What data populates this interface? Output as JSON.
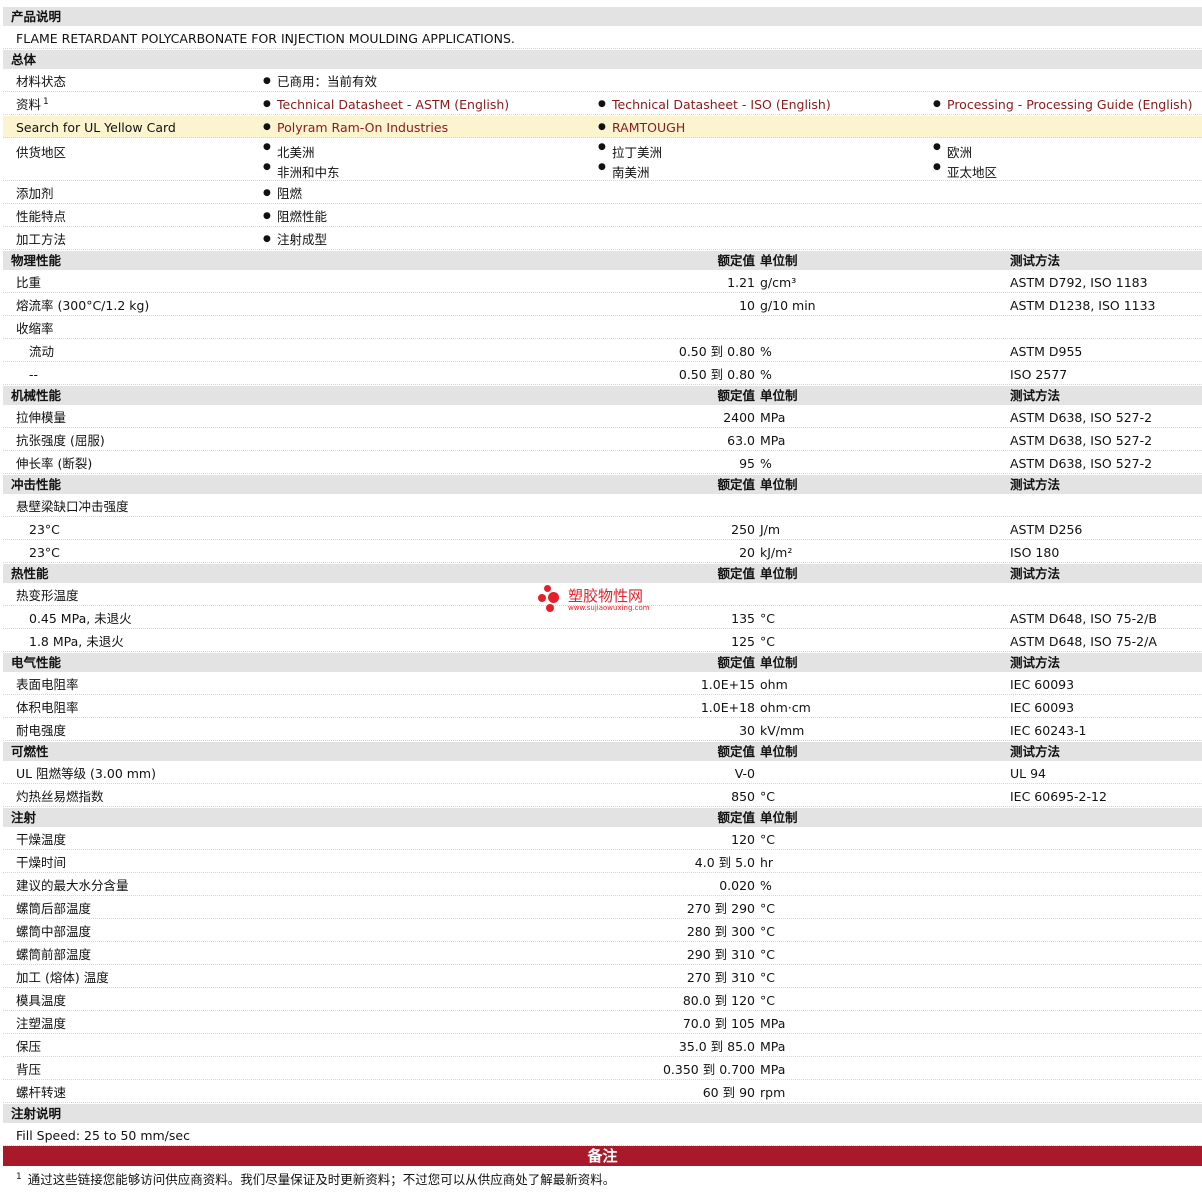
{
  "product_description": {
    "header": "产品说明",
    "text": "FLAME RETARDANT POLYCARBONATE FOR INJECTION MOULDING APPLICATIONS."
  },
  "general": {
    "header": "总体",
    "material_status": {
      "label": "材料状态",
      "value": "已商用：当前有效"
    },
    "documents": {
      "label": "资料",
      "footnote": "1",
      "links": [
        "Technical Datasheet - ASTM (English)",
        "Technical Datasheet - ISO (English)",
        "Processing - Processing Guide (English)"
      ]
    },
    "ul_card": {
      "label": "Search for UL Yellow Card",
      "links": [
        "Polyram Ram-On Industries",
        "RAMTOUGH"
      ]
    },
    "availability": {
      "label": "供货地区",
      "values": [
        "北美洲",
        "拉丁美洲",
        "欧洲",
        "非洲和中东",
        "南美洲",
        "亚太地区"
      ]
    },
    "additive": {
      "label": "添加剂",
      "value": "阻燃"
    },
    "features": {
      "label": "性能特点",
      "value": "阻燃性能"
    },
    "processing": {
      "label": "加工方法",
      "value": "注射成型"
    }
  },
  "column_headers": {
    "nominal": "额定值",
    "unit": "单位制",
    "method": "测试方法"
  },
  "physical": {
    "header": "物理性能",
    "rows": [
      {
        "label": "比重",
        "value": "1.21",
        "unit": "g/cm³",
        "method": "ASTM D792, ISO 1183"
      },
      {
        "label": "熔流率 (300°C/1.2 kg)",
        "value": "10",
        "unit": "g/10 min",
        "method": "ASTM D1238, ISO 1133"
      },
      {
        "label": "收缩率",
        "value": "",
        "unit": "",
        "method": ""
      },
      {
        "label": "流动",
        "value": "0.50 到  0.80",
        "unit": "%",
        "method": "ASTM D955"
      },
      {
        "label": "--",
        "value": "0.50 到  0.80",
        "unit": "%",
        "method": "ISO 2577"
      }
    ]
  },
  "mechanical": {
    "header": "机械性能",
    "rows": [
      {
        "label": "拉伸模量",
        "value": "2400",
        "unit": "MPa",
        "method": "ASTM D638, ISO 527-2"
      },
      {
        "label": "抗张强度 (屈服)",
        "value": "63.0",
        "unit": "MPa",
        "method": "ASTM D638, ISO 527-2"
      },
      {
        "label": "伸长率 (断裂)",
        "value": "95",
        "unit": "%",
        "method": "ASTM D638, ISO 527-2"
      }
    ]
  },
  "impact": {
    "header": "冲击性能",
    "rows": [
      {
        "label": "悬壁梁缺口冲击强度",
        "value": "",
        "unit": "",
        "method": ""
      },
      {
        "label": "23°C",
        "value": "250",
        "unit": "J/m",
        "method": "ASTM D256"
      },
      {
        "label": "23°C",
        "value": "20",
        "unit": "kJ/m²",
        "method": "ISO 180"
      }
    ]
  },
  "thermal": {
    "header": "热性能",
    "rows": [
      {
        "label": "热变形温度",
        "value": "",
        "unit": "",
        "method": ""
      },
      {
        "label": "0.45 MPa, 未退火",
        "value": "135",
        "unit": "°C",
        "method": "ASTM D648, ISO 75-2/B"
      },
      {
        "label": "1.8 MPa, 未退火",
        "value": "125",
        "unit": "°C",
        "method": "ASTM D648, ISO 75-2/A"
      }
    ]
  },
  "electrical": {
    "header": "电气性能",
    "rows": [
      {
        "label": "表面电阻率",
        "value": "1.0E+15",
        "unit": "ohm",
        "method": "IEC 60093"
      },
      {
        "label": "体积电阻率",
        "value": "1.0E+18",
        "unit": "ohm·cm",
        "method": "IEC 60093"
      },
      {
        "label": "耐电强度",
        "value": "30",
        "unit": "kV/mm",
        "method": "IEC 60243-1"
      }
    ]
  },
  "flammability": {
    "header": "可燃性",
    "rows": [
      {
        "label": "UL 阻燃等级 (3.00 mm)",
        "value": "V-0",
        "unit": "",
        "method": "UL 94"
      },
      {
        "label": "灼热丝易燃指数",
        "value": "850",
        "unit": "°C",
        "method": "IEC 60695-2-12"
      }
    ]
  },
  "injection": {
    "header": "注射",
    "rows": [
      {
        "label": "干燥温度",
        "value": "120",
        "unit": "°C"
      },
      {
        "label": "干燥时间",
        "value": "4.0 到  5.0",
        "unit": "hr"
      },
      {
        "label": "建议的最大水分含量",
        "value": "0.020",
        "unit": "%"
      },
      {
        "label": "螺筒后部温度",
        "value": "270 到  290",
        "unit": "°C"
      },
      {
        "label": "螺筒中部温度",
        "value": "280 到  300",
        "unit": "°C"
      },
      {
        "label": "螺筒前部温度",
        "value": "290 到  310",
        "unit": "°C"
      },
      {
        "label": "加工 (熔体) 温度",
        "value": "270 到  310",
        "unit": "°C"
      },
      {
        "label": "模具温度",
        "value": "80.0 到  120",
        "unit": "°C"
      },
      {
        "label": "注塑温度",
        "value": "70.0 到  105",
        "unit": "MPa"
      },
      {
        "label": "保压",
        "value": "35.0 到  85.0",
        "unit": "MPa"
      },
      {
        "label": "背压",
        "value": "0.350 到  0.700",
        "unit": "MPa"
      },
      {
        "label": "螺杆转速",
        "value": "60 到  90",
        "unit": "rpm"
      }
    ]
  },
  "injection_notes": {
    "header": "注射说明",
    "text": "Fill Speed: 25 to 50 mm/sec"
  },
  "remarks": {
    "header": "备注",
    "footnote_number": "1",
    "footnote_text": "通过这些链接您能够访问供应商资料。我们尽量保证及时更新资料；不过您可以从供应商处了解最新资料。"
  },
  "watermark": {
    "name": "塑胶物性网",
    "url": "www.sujiaowuxing.com"
  },
  "colors": {
    "section_bg": "#e3e3e3",
    "link": "#8b1a1a",
    "highlight_row": "#fbf4cf",
    "remarks_bar": "#a8192a",
    "watermark": "#e5202a"
  }
}
